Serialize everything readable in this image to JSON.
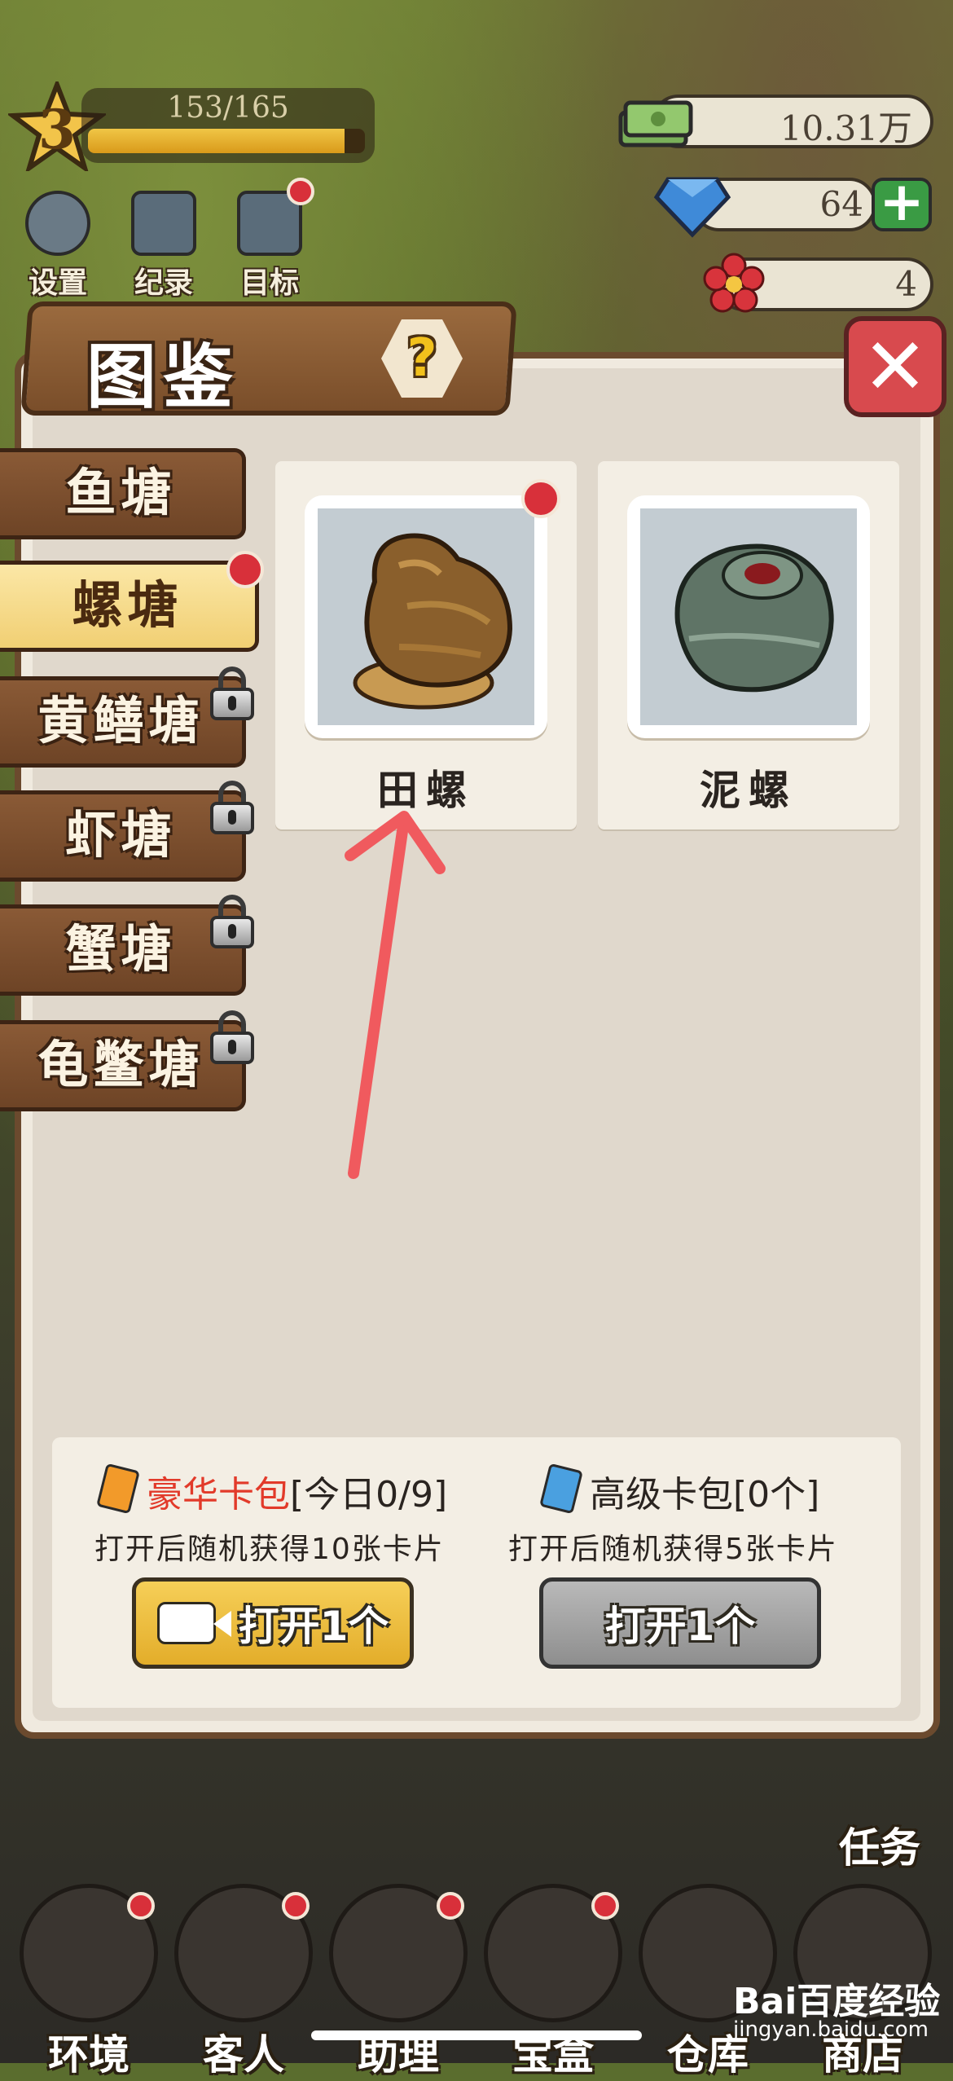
{
  "hud": {
    "level": "3",
    "xp_text": "153/165",
    "xp_progress": 0.927,
    "money": "10.31万",
    "gems": "64",
    "flowers": "4",
    "plus_label": "+",
    "top_icons": [
      {
        "label": "设置",
        "icon": "gear-icon"
      },
      {
        "label": "纪录",
        "icon": "notebook-icon"
      },
      {
        "label": "目标",
        "icon": "checklist-icon"
      }
    ]
  },
  "panel": {
    "title": "图鉴",
    "help_label": "?",
    "close_label": "✕"
  },
  "tabs": [
    {
      "label": "鱼塘",
      "active": false,
      "locked": false
    },
    {
      "label": "螺塘",
      "active": true,
      "locked": false
    },
    {
      "label": "黄鳝塘",
      "active": false,
      "locked": true
    },
    {
      "label": "虾塘",
      "active": false,
      "locked": true
    },
    {
      "label": "蟹塘",
      "active": false,
      "locked": true
    },
    {
      "label": "龟鳖塘",
      "active": false,
      "locked": true
    }
  ],
  "cards": [
    {
      "name": "田螺",
      "icon": "field-snail-icon",
      "new": true
    },
    {
      "name": "泥螺",
      "icon": "mud-snail-icon",
      "new": false
    }
  ],
  "packs": {
    "luxury": {
      "name": "豪华卡包",
      "count": "[今日0/9]",
      "desc": "打开后随机获得10张卡片",
      "button": "打开1个"
    },
    "advanced": {
      "name": "高级卡包",
      "count": "[0个]",
      "desc": "打开后随机获得5张卡片",
      "button": "打开1个"
    }
  },
  "bottom_nav": [
    {
      "label": "环境"
    },
    {
      "label": "客人"
    },
    {
      "label": "助理"
    },
    {
      "label": "宝盒"
    },
    {
      "label": "仓库"
    },
    {
      "label": "商店"
    }
  ],
  "task_label": "任务",
  "watermark": {
    "brand": "Bai百度经验",
    "url": "jingyan.baidu.com"
  },
  "colors": {
    "accent_gold": "#f1cf73",
    "wood": "#7a4e2a",
    "alert_red": "#d8303a",
    "luxury_red": "#e23a2a"
  }
}
